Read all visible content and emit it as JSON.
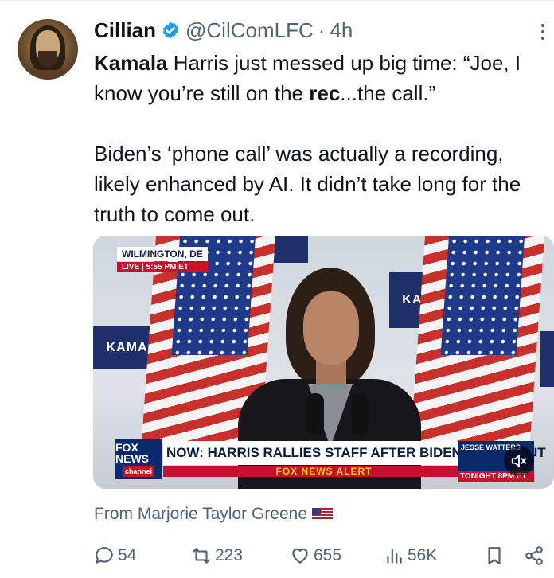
{
  "author": {
    "name": "Cillian",
    "handle": "@CilComLFC",
    "separator": "·",
    "time": "4h"
  },
  "tweet": {
    "line1_bold": "Kamala",
    "line1_rest": " Harris just messed up big time: “Joe, I know you’re still on the ",
    "line1_bold2": "rec",
    "line1_end": "...the call.”",
    "paragraph2": "Biden’s ‘phone call’ was actually a recording, likely enhanced by AI. It didn’t take long for the truth to come out."
  },
  "media": {
    "location": "WILMINGTON, DE",
    "live_label": "LIVE",
    "live_time": "5:55 PM ET",
    "sign_left": "KAMAL",
    "sign_right": "KAM",
    "network_logo": "FOX NEWS",
    "network_sub": "channel",
    "headline": "NOW: HARRIS RALLIES STAFF AFTER BIDEN DROPS OUT",
    "alert": "FOX NEWS ALERT",
    "promo_top": "JESSE WATTERS",
    "promo_bottom": "TONIGHT 8PM ET"
  },
  "attribution": {
    "text": "From Marjorie Taylor Greene"
  },
  "actions": {
    "replies": "54",
    "retweets": "223",
    "likes": "655",
    "views": "56K"
  },
  "colors": {
    "verified": "#1d9bf0",
    "secondary_text": "#536471"
  }
}
